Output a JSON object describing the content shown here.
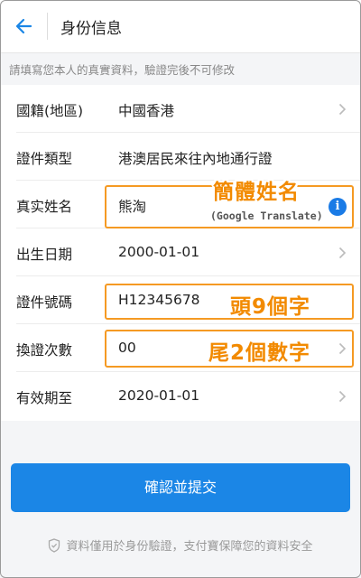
{
  "header": {
    "title": "身份信息"
  },
  "notice": "請填寫您本人的真實資料，驗證完後不可修改",
  "rows": [
    {
      "label": "國籍(地區)",
      "value": "中國香港"
    },
    {
      "label": "證件類型",
      "value": "港澳居民來往內地通行證"
    },
    {
      "label": "真实姓名",
      "value": "熊淘"
    },
    {
      "label": "出生日期",
      "value": "2000-01-01"
    },
    {
      "label": "證件號碼",
      "value": "H12345678"
    },
    {
      "label": "換證次數",
      "value": "00"
    },
    {
      "label": "有效期至",
      "value": "2020-01-01"
    }
  ],
  "annotations": {
    "name": "簡體姓名",
    "google": "(Google Translate)",
    "id_first": "頭9個字",
    "last_two": "尾2個數字"
  },
  "submit_label": "確認並提交",
  "footer": "資料僅用於身份驗證，支付寶保障您的資料安全",
  "colors": {
    "accent": "#1b86e6",
    "annotation": "#f59a23"
  }
}
